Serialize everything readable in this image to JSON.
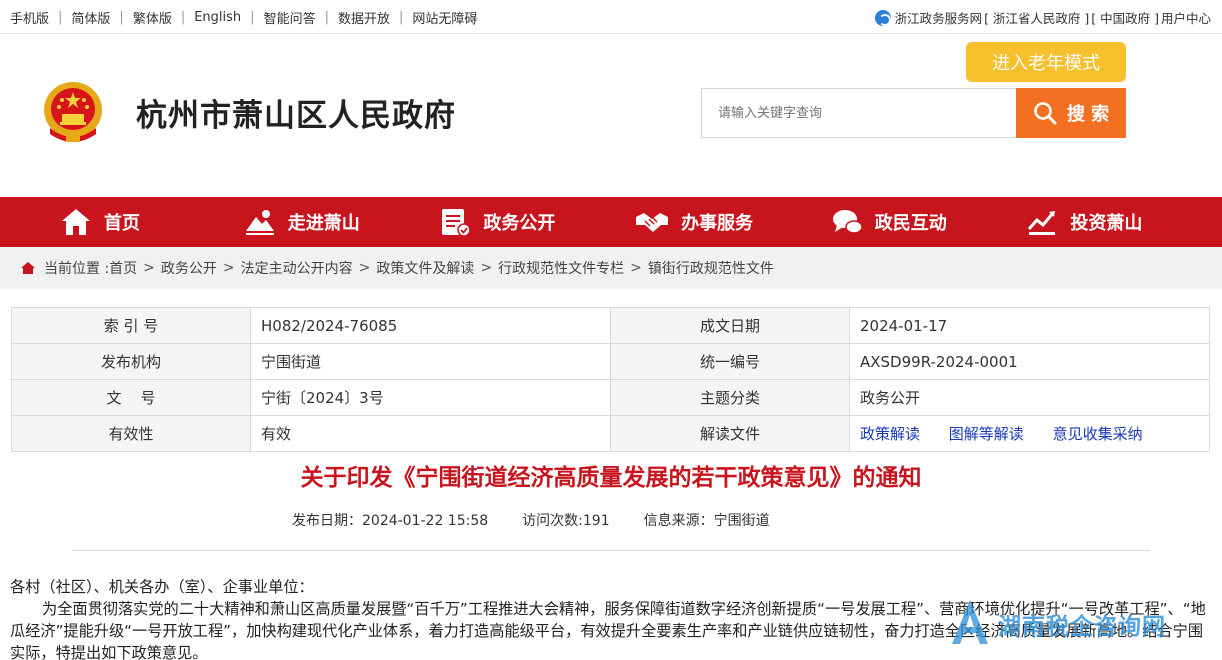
{
  "topbar": {
    "left_links": [
      "手机版",
      "简体版",
      "繁体版",
      "English",
      "智能问答",
      "数据开放",
      "网站无障碍"
    ],
    "right_text_1": "浙江政务服务网",
    "right_text_2": "[ 浙江省人民政府 ]",
    "right_text_3": "[ 中国政府 ]",
    "right_text_4": "用户中心"
  },
  "header": {
    "site_title": "杭州市萧山区人民政府",
    "elder_mode": "进入老年模式",
    "search_placeholder": "请输入关键字查询",
    "search_button": "搜 索"
  },
  "nav": {
    "items": [
      {
        "label": "首页",
        "icon": "home-icon"
      },
      {
        "label": "走进萧山",
        "icon": "landscape-icon"
      },
      {
        "label": "政务公开",
        "icon": "document-icon"
      },
      {
        "label": "办事服务",
        "icon": "handshake-icon"
      },
      {
        "label": "政民互动",
        "icon": "chat-icon"
      },
      {
        "label": "投资萧山",
        "icon": "chart-icon"
      }
    ]
  },
  "breadcrumb": {
    "prefix": "当前位置 :",
    "items": [
      "首页",
      "政务公开",
      "法定主动公开内容",
      "政策文件及解读",
      "行政规范性文件专栏",
      "镇街行政规范性文件"
    ]
  },
  "meta": {
    "rows": [
      {
        "l1": "索 引 号",
        "v1": "H082/2024-76085",
        "l2": "成文日期",
        "v2": "2024-01-17"
      },
      {
        "l1": "发布机构",
        "v1": "宁围街道",
        "l2": "统一编号",
        "v2": "AXSD99R-2024-0001"
      },
      {
        "l1": "文    号",
        "v1": "宁街〔2024〕3号",
        "l2": "主题分类",
        "v2": "政务公开"
      },
      {
        "l1": "有效性",
        "v1": "有效",
        "l2": "解读文件"
      }
    ],
    "links": [
      "政策解读",
      "图解等解读",
      "意见收集采纳"
    ]
  },
  "doc": {
    "title": "关于印发《宁围街道经济高质量发展的若干政策意见》的通知",
    "publish_date": "发布日期：2024-01-22 15:58",
    "visits": "访问次数:191",
    "source": "信息来源：宁围街道",
    "salutation": "各村（社区）、机关各办（室）、企事业单位：",
    "paragraph": "为全面贯彻落实党的二十大精神和萧山区高质量发展暨“百千万”工程推进大会精神，服务保障街道数字经济创新提质“一号发展工程”、营商环境优化提升“一号改革工程”、“地瓜经济”提能升级“一号开放工程”，加快构建现代化产业体系，着力打造高能级平台，有效提升全要素生产率和产业链供应链韧性，奋力打造全区经济高质量发展新高地。结合宁围实际，特提出如下政策意见。"
  },
  "watermark": {
    "text": "湖南税企咨询网"
  },
  "colors": {
    "nav_red": "#c8151d",
    "search_orange": "#f36f21",
    "elder_yellow": "#f5c02c",
    "link_blue": "#1a3ab6"
  }
}
